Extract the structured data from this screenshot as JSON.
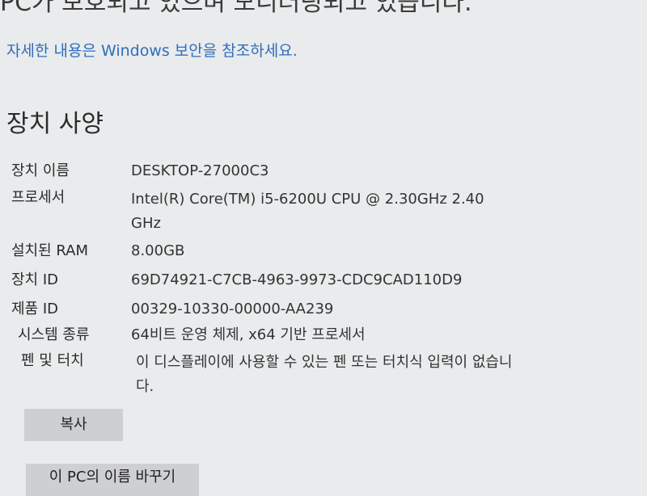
{
  "header": {
    "cut_text": "PC가 보호되고 있으며 모니터링되고 있습니다."
  },
  "security": {
    "link_text": "자세한 내용은 Windows 보안을 참조하세요."
  },
  "device_specs": {
    "title": "장치 사양",
    "rows": [
      {
        "label": "장치 이름",
        "value": "DESKTOP-27000C3"
      },
      {
        "label": "프로세서",
        "value": "Intel(R) Core(TM) i5-6200U CPU @ 2.30GHz   2.40 GHz"
      },
      {
        "label": "설치된 RAM",
        "value": "8.00GB"
      },
      {
        "label": "장치 ID",
        "value": "69D74921-C7CB-4963-9973-CDC9CAD110D9"
      },
      {
        "label": "제품 ID",
        "value": "00329-10330-00000-AA239"
      },
      {
        "label": "시스템 종류",
        "value": "64비트 운영 체제, x64 기반 프로세서"
      },
      {
        "label": "펜 및 터치",
        "value": "이 디스플레이에 사용할 수 있는 펜 또는 터치식 입력이 없습니다."
      }
    ]
  },
  "buttons": {
    "copy_label": "복사",
    "rename_label": "이 PC의 이름 바꾸기"
  }
}
